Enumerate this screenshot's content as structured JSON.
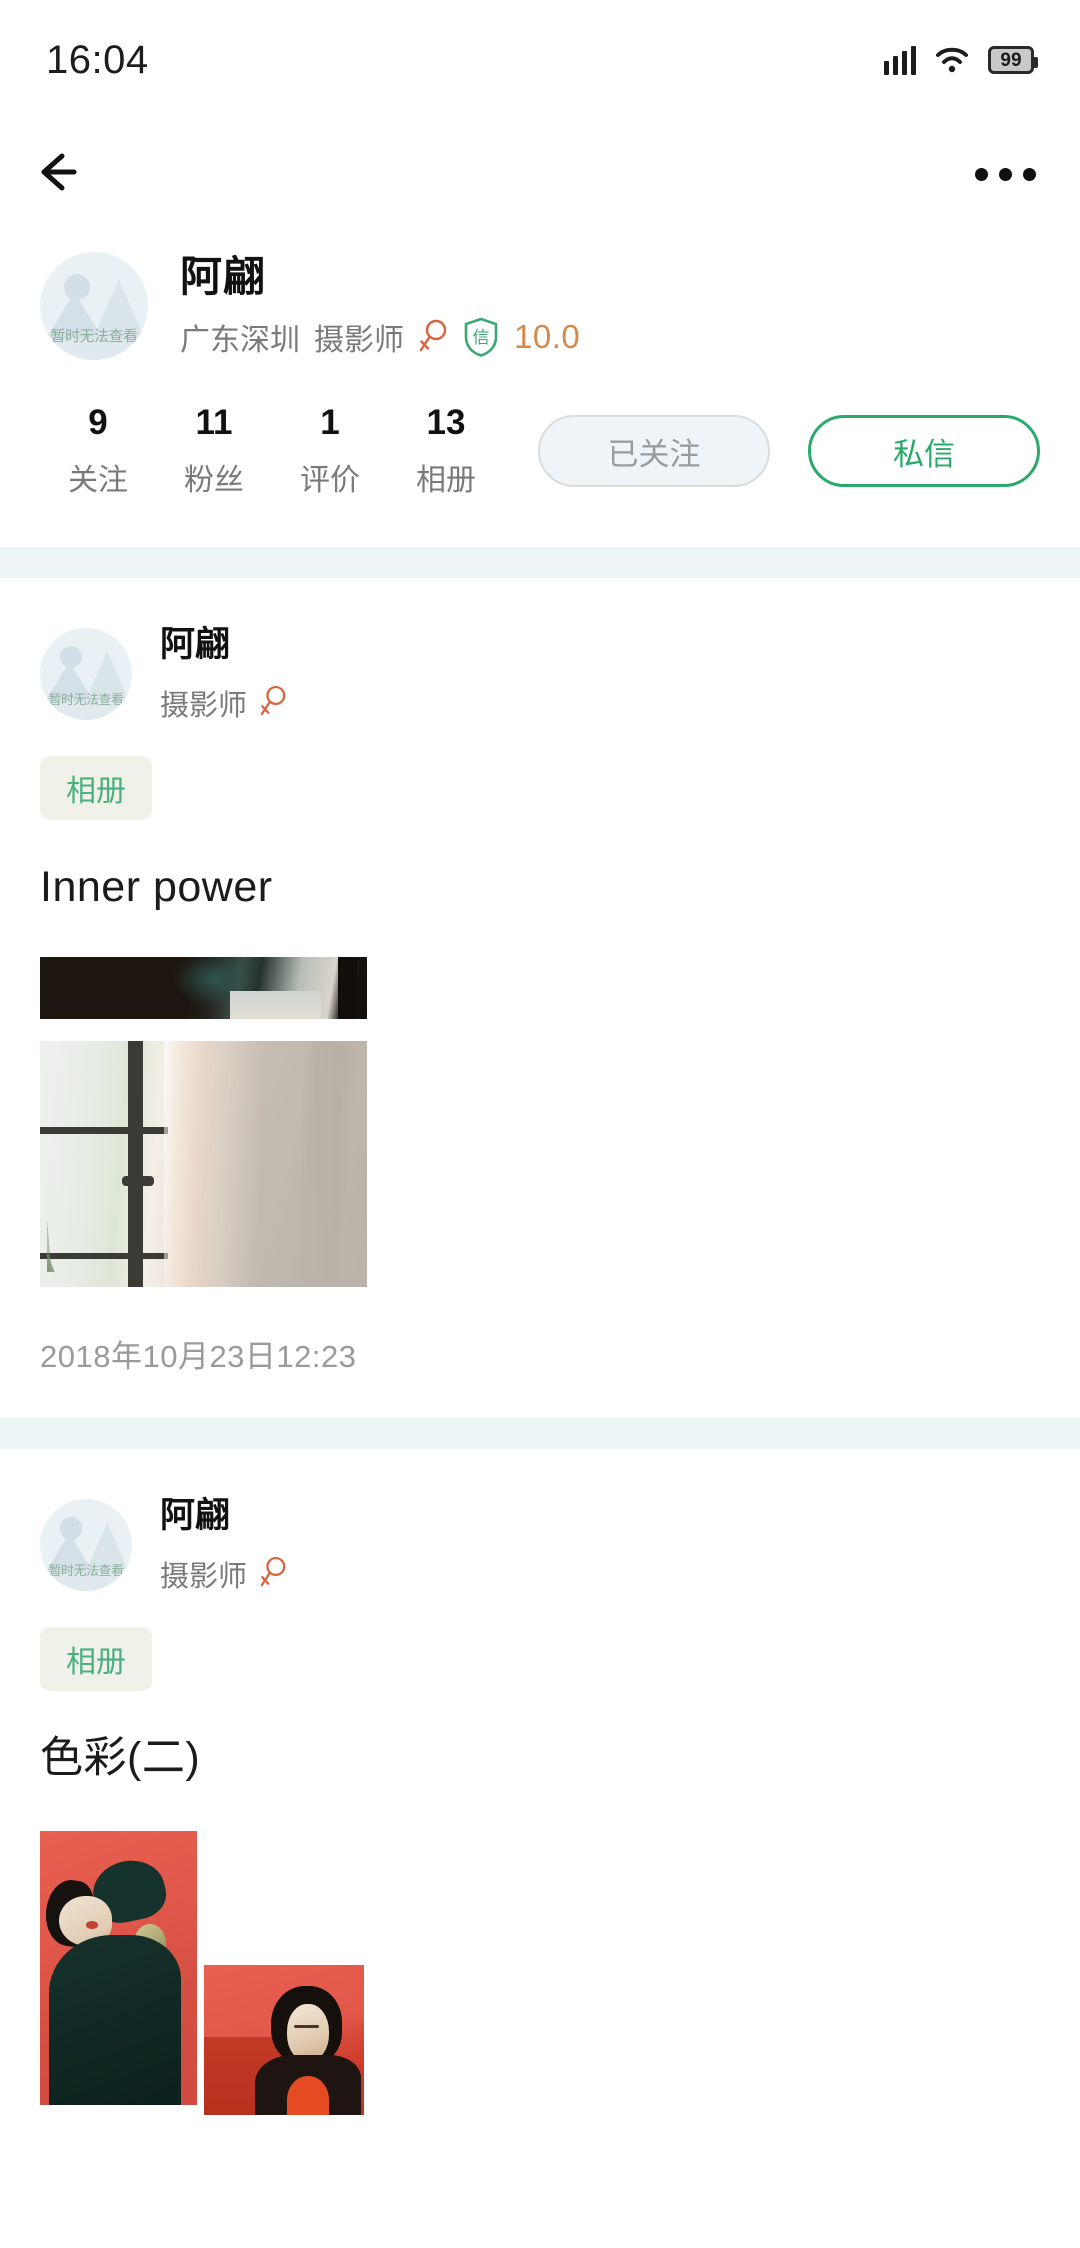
{
  "status_bar": {
    "time": "16:04",
    "battery_level": "99",
    "signal_icon": "signal-bars-icon",
    "wifi_icon": "wifi-icon",
    "battery_icon": "battery-icon"
  },
  "nav": {
    "back_icon": "back-arrow-icon",
    "more_icon": "more-options-icon"
  },
  "profile": {
    "avatar_placeholder_text": "暂时无法查看",
    "name": "阿翩",
    "location": "广东深圳",
    "role": "摄影师",
    "gender_icon": "female-gender-icon",
    "verify_badge_text": "信",
    "rating": "10.0",
    "rating_color": "#d38a4a",
    "stats": [
      {
        "value": "9",
        "label": "关注"
      },
      {
        "value": "11",
        "label": "粉丝"
      },
      {
        "value": "1",
        "label": "评价"
      },
      {
        "value": "13",
        "label": "相册"
      }
    ],
    "follow_button": "已关注",
    "message_button": "私信",
    "accent_color": "#29a96c"
  },
  "posts": [
    {
      "avatar_placeholder_text": "暂时无法查看",
      "author": "阿翩",
      "role": "摄影师",
      "gender_icon": "female-gender-icon",
      "tag": "相册",
      "title": "Inner power",
      "timestamp": "2018年10月23日12:23"
    },
    {
      "avatar_placeholder_text": "暂时无法查看",
      "author": "阿翩",
      "role": "摄影师",
      "gender_icon": "female-gender-icon",
      "tag": "相册",
      "title": "色彩(二)",
      "timestamp": ""
    }
  ]
}
